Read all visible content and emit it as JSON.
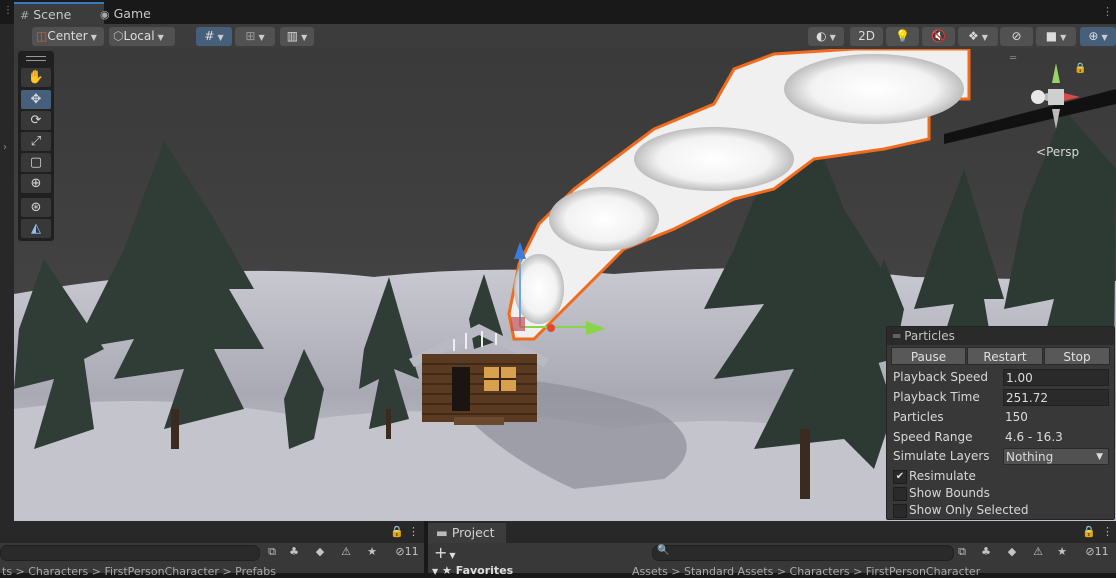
{
  "tabs": [
    {
      "label": "Scene",
      "icon": "grid-icon"
    },
    {
      "label": "Game",
      "icon": "gamepad-icon"
    }
  ],
  "toolbar": {
    "pivot_label": "Center",
    "space_label": "Local",
    "mode_2d_label": "2D"
  },
  "gizmo": {
    "persp_label": "Persp"
  },
  "particles": {
    "title": "Particles",
    "buttons": {
      "pause": "Pause",
      "restart": "Restart",
      "stop": "Stop"
    },
    "rows": {
      "playback_speed": {
        "label": "Playback Speed",
        "value": "1.00"
      },
      "playback_time": {
        "label": "Playback Time",
        "value": "251.72"
      },
      "particles": {
        "label": "Particles",
        "value": "150"
      },
      "speed_range": {
        "label": "Speed Range",
        "value": "4.6 - 16.3"
      },
      "simulate_layers": {
        "label": "Simulate Layers",
        "value": "Nothing"
      }
    },
    "checks": {
      "resimulate": {
        "label": "Resimulate",
        "checked": true
      },
      "show_bounds": {
        "label": "Show Bounds",
        "checked": false
      },
      "show_only_selected": {
        "label": "Show Only Selected",
        "checked": false
      }
    }
  },
  "bottom": {
    "left_hidden_count": "11",
    "left_breadcrumb": "ts > Characters > FirstPersonCharacter > Prefabs",
    "project_tab": "Project",
    "add_label": "+",
    "favorites": "Favorites",
    "right_hidden_count": "11",
    "right_breadcrumb": "Assets > Standard Assets > Characters > FirstPersonCharacter"
  },
  "colors": {
    "accent": "#3a79bb",
    "selection_outline": "#f26b1d",
    "toolbar_bg": "#3c3c3c",
    "panel_bg": "#383838"
  }
}
